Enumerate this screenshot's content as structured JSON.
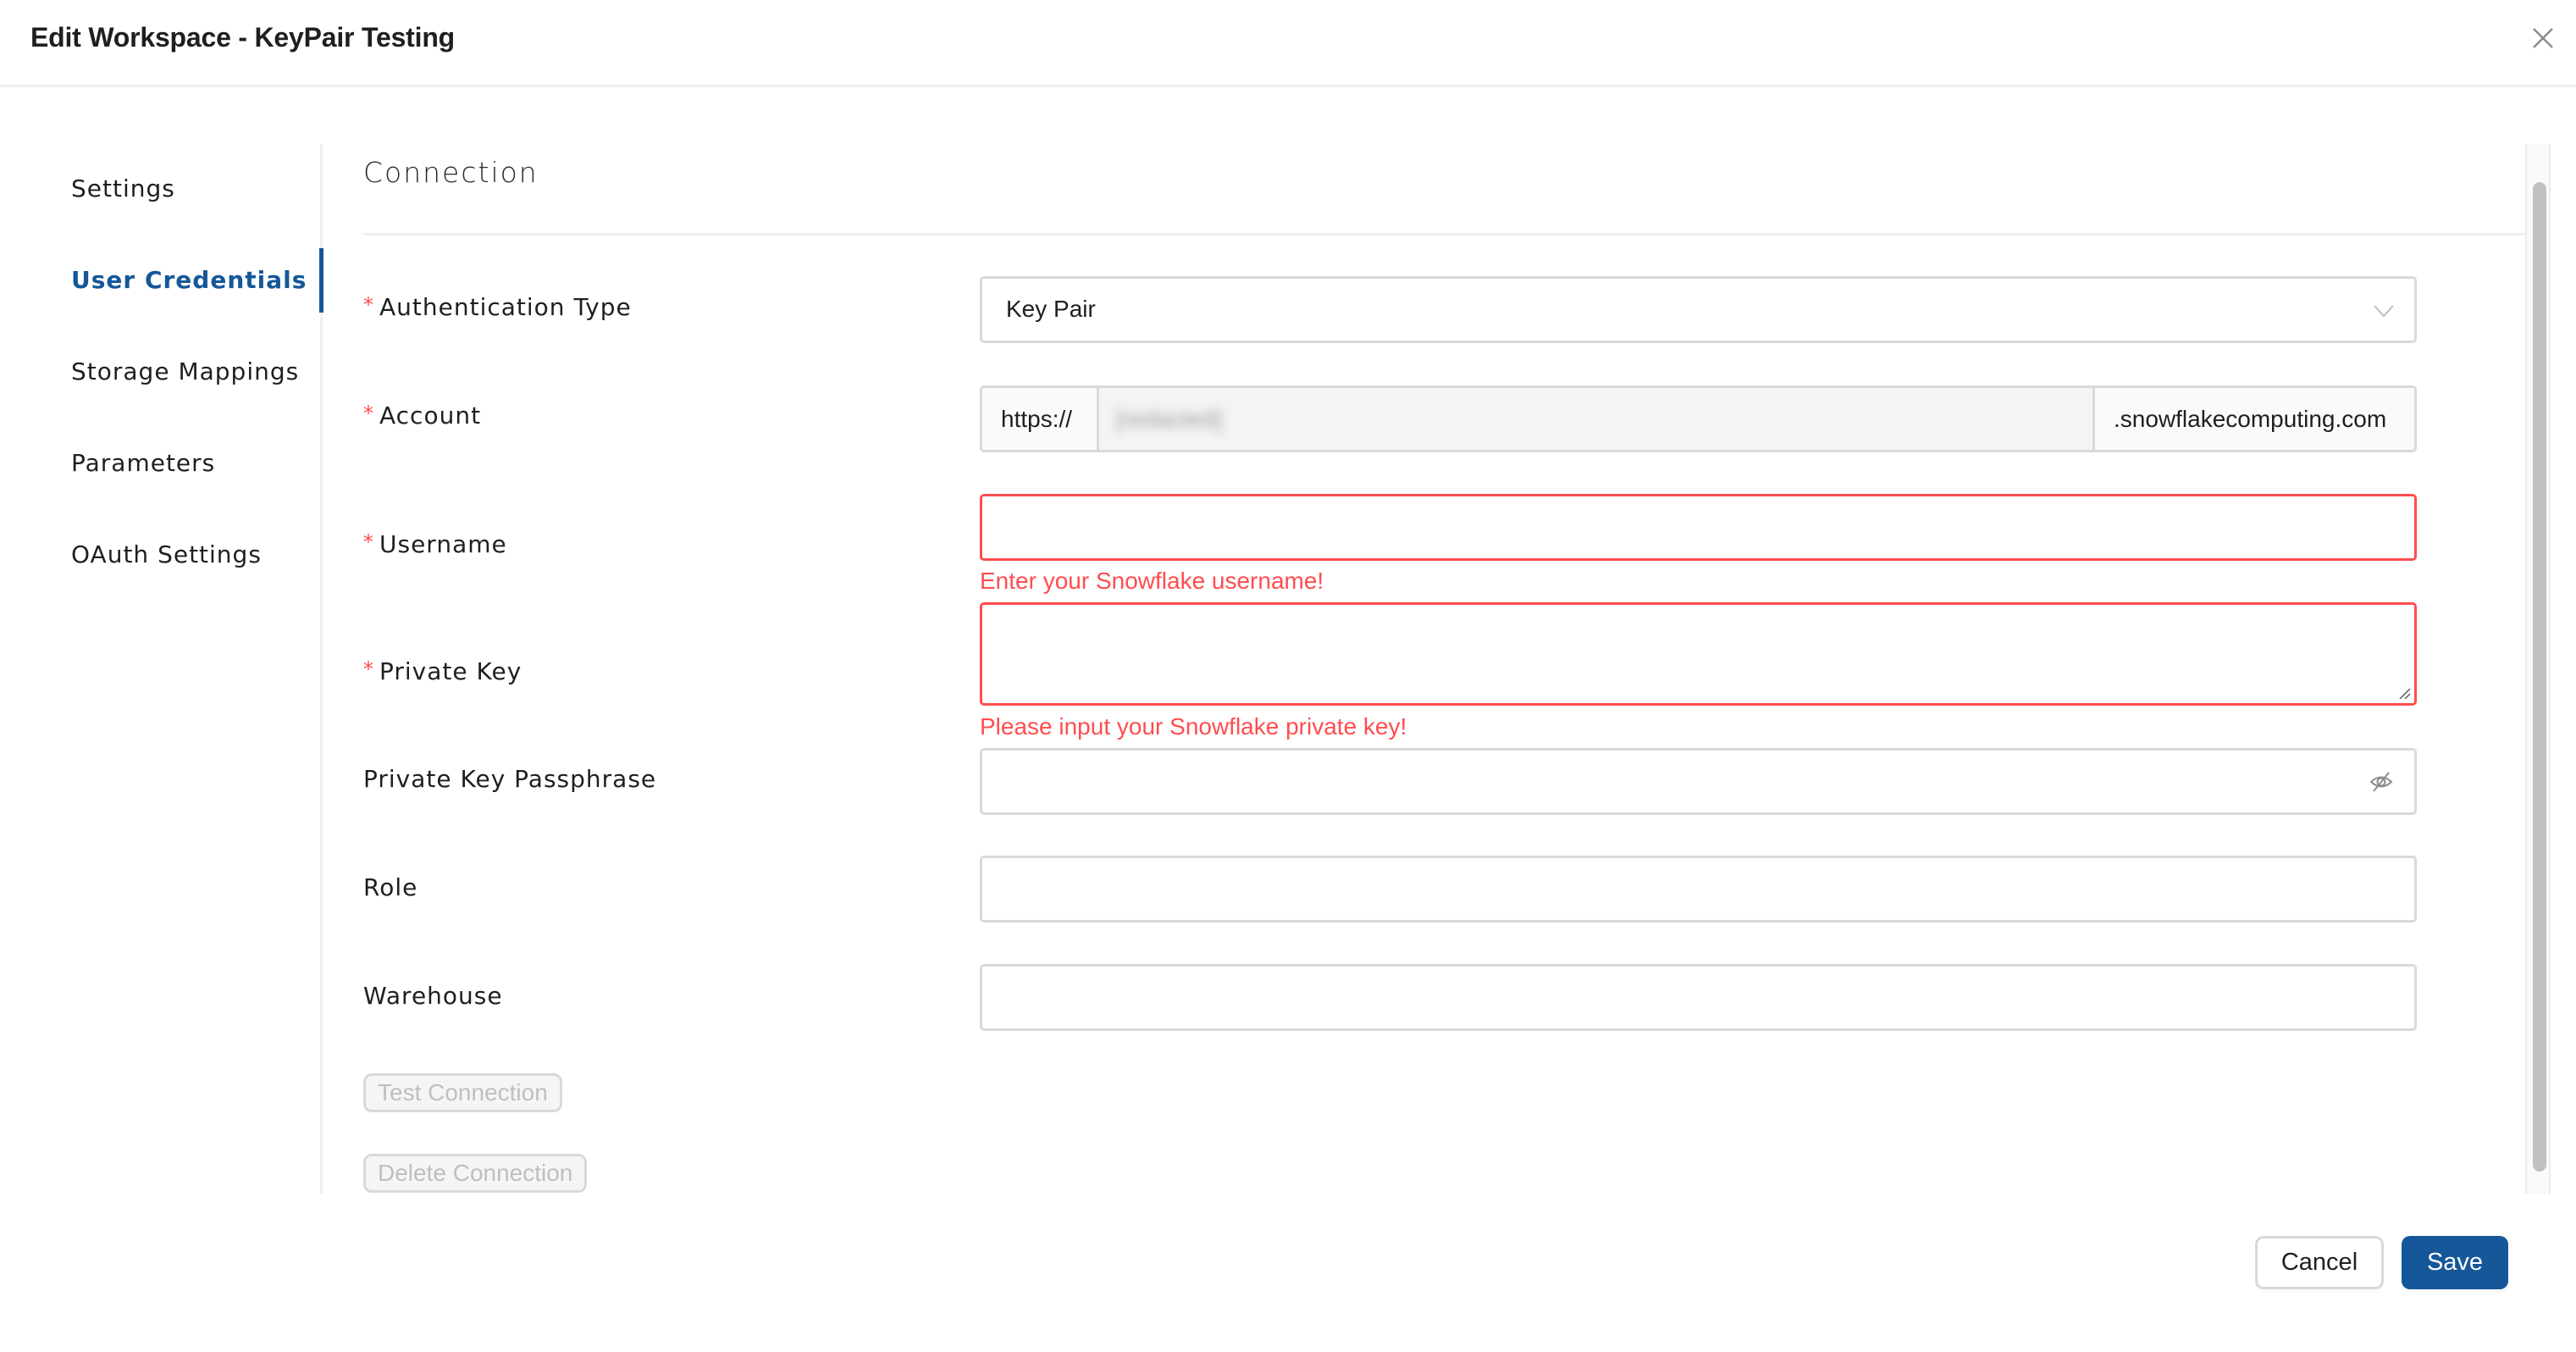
{
  "header": {
    "title": "Edit Workspace - KeyPair Testing",
    "close_icon": "close-icon"
  },
  "sidebar": {
    "items": [
      {
        "label": "Settings",
        "active": false
      },
      {
        "label": "User Credentials",
        "active": true
      },
      {
        "label": "Storage Mappings",
        "active": false
      },
      {
        "label": "Parameters",
        "active": false
      },
      {
        "label": "OAuth Settings",
        "active": false
      }
    ]
  },
  "main": {
    "section_title": "Connection",
    "fields": {
      "auth_type": {
        "label": "Authentication Type",
        "required": true,
        "value": "Key Pair",
        "icon": "chevron-down-icon"
      },
      "account": {
        "label": "Account",
        "required": true,
        "prefix": "https://",
        "value": "[redacted]",
        "suffix": ".snowflakecomputing.com",
        "disabled": true
      },
      "username": {
        "label": "Username",
        "required": true,
        "value": "",
        "error": "Enter your Snowflake username!"
      },
      "private_key": {
        "label": "Private Key",
        "required": true,
        "value": "",
        "error": "Please input your Snowflake private key!"
      },
      "passphrase": {
        "label": "Private Key Passphrase",
        "required": false,
        "value": "",
        "icon": "eye-invisible-icon"
      },
      "role": {
        "label": "Role",
        "required": false,
        "value": ""
      },
      "warehouse": {
        "label": "Warehouse",
        "required": false,
        "value": ""
      }
    },
    "buttons": {
      "test_connection": "Test Connection",
      "delete_connection": "Delete Connection"
    }
  },
  "footer": {
    "cancel_label": "Cancel",
    "save_label": "Save"
  },
  "colors": {
    "accent": "#155799",
    "error": "#ff4d4f",
    "border": "#d9d9d9",
    "disabled_text": "#bfbfbf"
  },
  "required_marker": "*"
}
